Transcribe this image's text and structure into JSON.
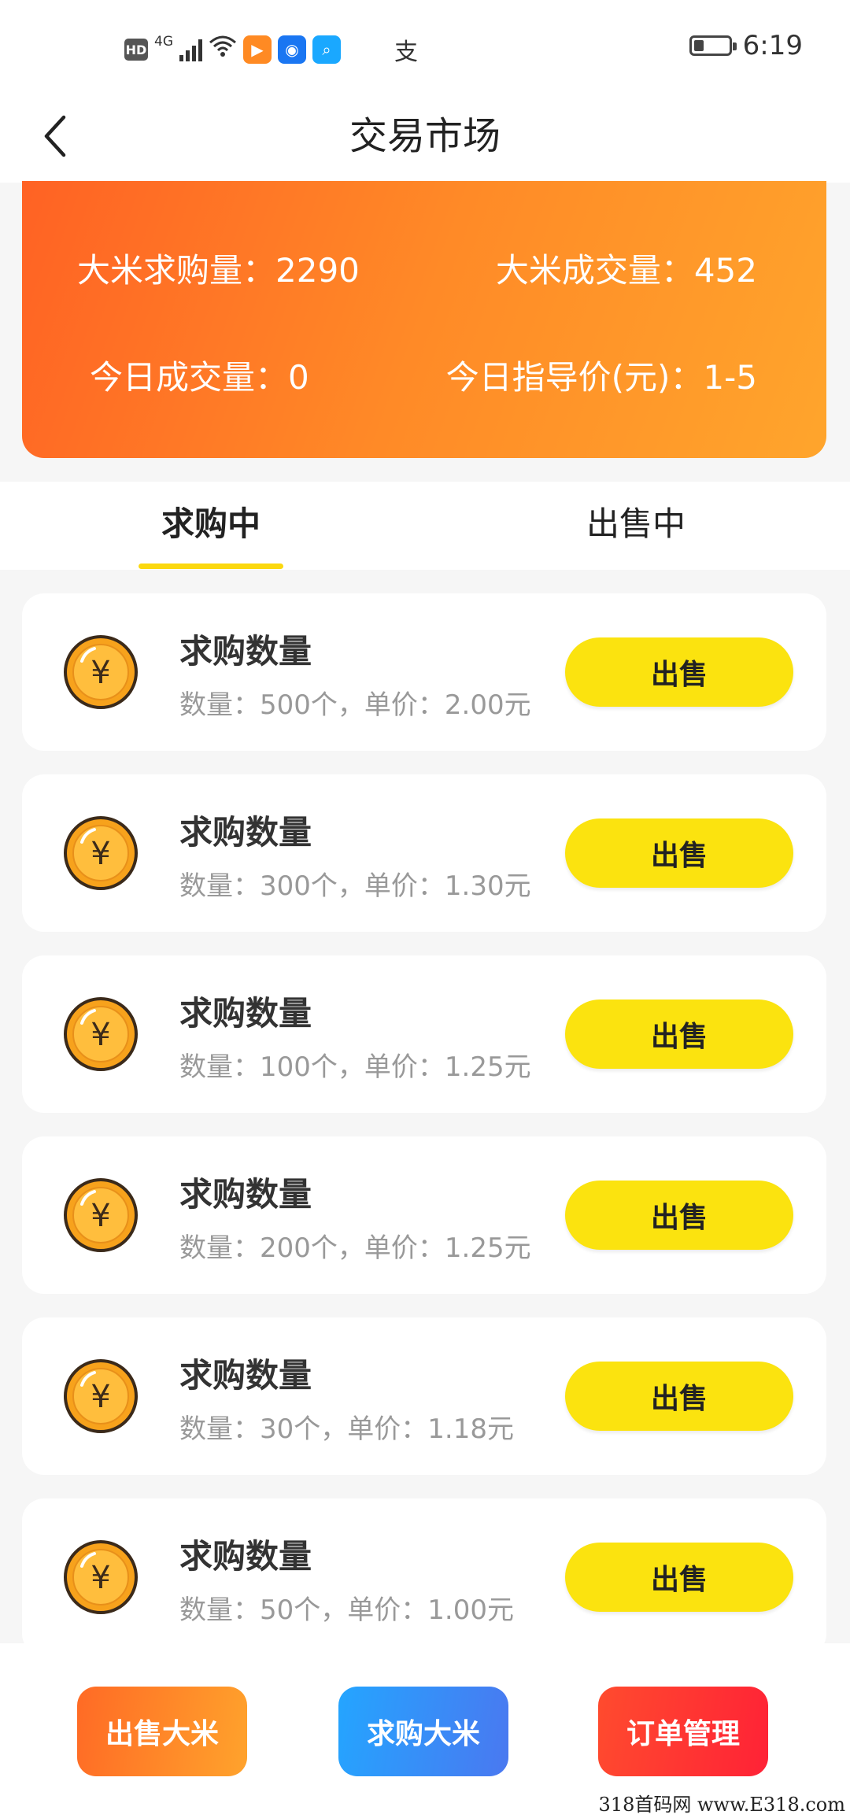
{
  "status_bar": {
    "network_badge": "HD",
    "network_type": "4G",
    "time": "6:19",
    "alipay_glyph": "支",
    "app_icons": [
      {
        "name": "video-app-icon",
        "color": "#ff8a23",
        "glyph": "▶"
      },
      {
        "name": "bulb-app-icon",
        "color": "#1a76f2",
        "glyph": "◉"
      },
      {
        "name": "search-app-icon",
        "color": "#1aa8ff",
        "glyph": "⌕"
      }
    ]
  },
  "header": {
    "title": "交易市场"
  },
  "stats": {
    "rice_demand": "大米求购量：2290",
    "rice_volume": "大米成交量：452",
    "today_volume": "今日成交量：0",
    "today_price": "今日指导价(元)：1-5"
  },
  "tabs": [
    {
      "label": "求购中",
      "active": true
    },
    {
      "label": "出售中",
      "active": false
    }
  ],
  "orders": [
    {
      "title": "求购数量",
      "detail": "数量：500个，单价：2.00元",
      "action": "出售"
    },
    {
      "title": "求购数量",
      "detail": "数量：300个，单价：1.30元",
      "action": "出售"
    },
    {
      "title": "求购数量",
      "detail": "数量：100个，单价：1.25元",
      "action": "出售"
    },
    {
      "title": "求购数量",
      "detail": "数量：200个，单价：1.25元",
      "action": "出售"
    },
    {
      "title": "求购数量",
      "detail": "数量：30个，单价：1.18元",
      "action": "出售"
    },
    {
      "title": "求购数量",
      "detail": "数量：50个，单价：1.00元",
      "action": "出售"
    }
  ],
  "bottom_actions": {
    "sell_rice": "出售大米",
    "buy_rice": "求购大米",
    "order_management": "订单管理"
  },
  "watermark": "318首码网 www.E318.com",
  "colors": {
    "accent_yellow": "#fbe30f",
    "orange": "#ff8a27",
    "blue": "#24a5ff",
    "red": "#ff2236"
  }
}
